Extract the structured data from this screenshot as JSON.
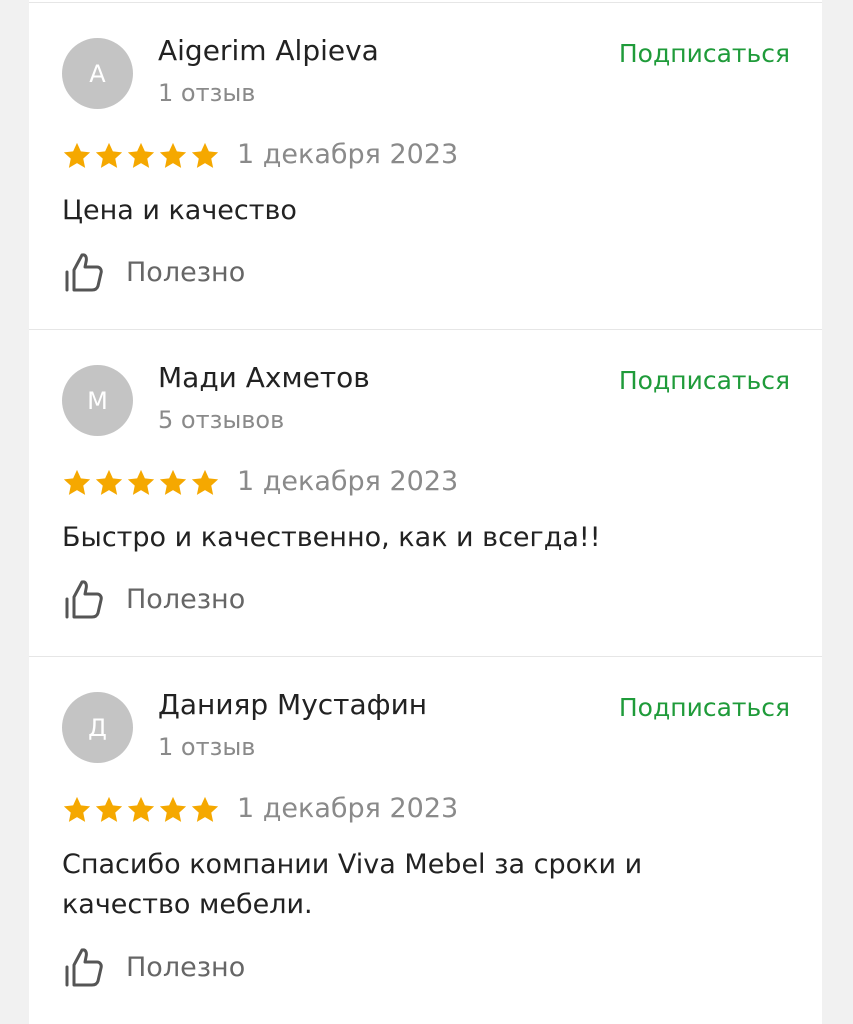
{
  "colors": {
    "subscribe": "#1f9b3a",
    "star": "#f5a800",
    "avatar": "#c4c4c4"
  },
  "reviews": [
    {
      "avatar_letter": "A",
      "author": "Aigerim Alpieva",
      "review_count": "1 отзыв",
      "subscribe_label": "Подписаться",
      "rating": 5,
      "date": "1 декабря 2023",
      "text": "Цена и качество",
      "helpful_label": "Полезно",
      "helpful_icon": "thumbs-up-icon"
    },
    {
      "avatar_letter": "М",
      "author": "Мади Ахметов",
      "review_count": "5 отзывов",
      "subscribe_label": "Подписаться",
      "rating": 5,
      "date": "1 декабря 2023",
      "text": "Быстро и качественно, как и всегда!!",
      "helpful_label": "Полезно",
      "helpful_icon": "thumbs-up-icon"
    },
    {
      "avatar_letter": "Д",
      "author": "Данияр Мустафин",
      "review_count": "1 отзыв",
      "subscribe_label": "Подписаться",
      "rating": 5,
      "date": "1 декабря 2023",
      "text": "Спасибо компании Viva Mebel за сроки и качество мебели.",
      "helpful_label": "Полезно",
      "helpful_icon": "thumbs-up-icon"
    }
  ]
}
